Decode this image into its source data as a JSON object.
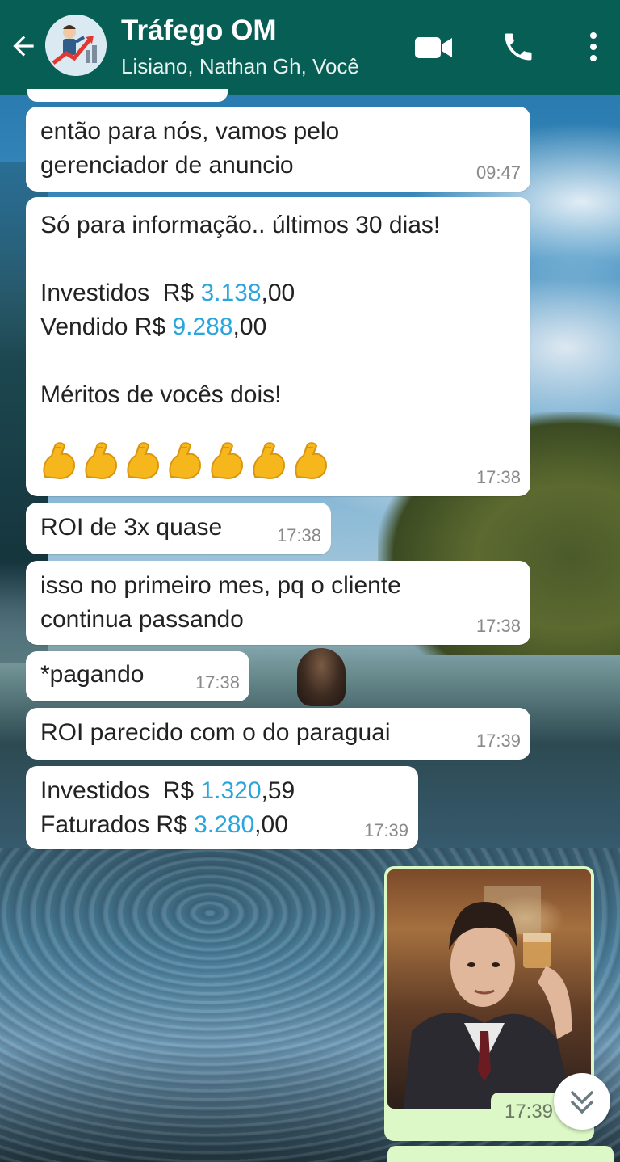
{
  "header": {
    "title": "Tráfego OM",
    "subtitle": "Lisiano, Nathan Gh, Você",
    "back_icon": "arrow-left-icon",
    "video_icon": "video-camera-icon",
    "call_icon": "phone-icon",
    "menu_icon": "more-vertical-icon",
    "bg_color": "#075e54"
  },
  "messages": [
    {
      "lines": [
        "então para nós, vamos pelo",
        "gerenciador de anuncio"
      ],
      "time": "09:47"
    },
    {
      "line1": "Só para informação.. últimos 30 dias!",
      "invest_label": "Investidos  R$ ",
      "invest_value": "3.138",
      "invest_suffix": ",00",
      "sold_label": "Vendido R$ ",
      "sold_value": "9.288",
      "sold_suffix": ",00",
      "line4": "Méritos de vocês dois!",
      "emoji": "flexed-biceps-icon",
      "emoji_count": 7,
      "time": "17:38"
    },
    {
      "text": "ROI de 3x quase",
      "time": "17:38"
    },
    {
      "lines": [
        "isso no primeiro mes, pq o cliente",
        "continua passando"
      ],
      "time": "17:38"
    },
    {
      "text": "*pagando",
      "time": "17:38"
    },
    {
      "text": "ROI parecido com o do paraguai",
      "time": "17:39"
    },
    {
      "invest_label": "Investidos  R$ ",
      "invest_value": "1.320",
      "invest_suffix": ",59",
      "billed_label": "Faturados R$ ",
      "billed_value": "3.280",
      "billed_suffix": ",00",
      "time": "17:39"
    },
    {
      "type": "image",
      "time": "17:39"
    }
  ],
  "scroll_button_icon": "double-chevron-down-icon",
  "colors": {
    "outgoing": "#dcf8c6",
    "incoming": "#ffffff",
    "number_highlight": "#2aa5dd"
  }
}
